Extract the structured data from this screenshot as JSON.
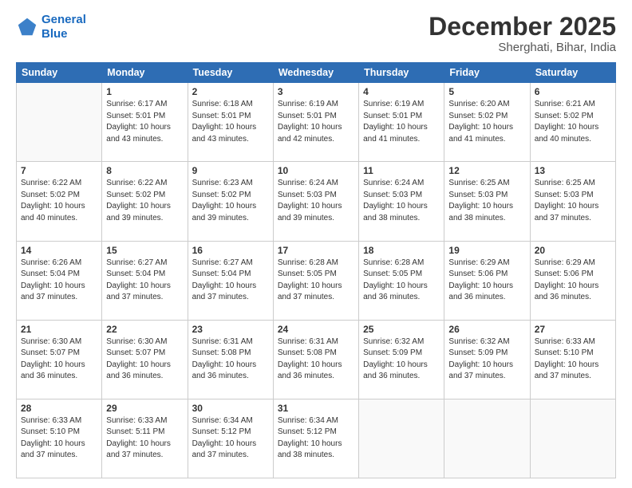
{
  "header": {
    "logo_line1": "General",
    "logo_line2": "Blue",
    "month": "December 2025",
    "location": "Sherghati, Bihar, India"
  },
  "weekdays": [
    "Sunday",
    "Monday",
    "Tuesday",
    "Wednesday",
    "Thursday",
    "Friday",
    "Saturday"
  ],
  "weeks": [
    [
      {
        "day": "",
        "info": ""
      },
      {
        "day": "1",
        "info": "Sunrise: 6:17 AM\nSunset: 5:01 PM\nDaylight: 10 hours\nand 43 minutes."
      },
      {
        "day": "2",
        "info": "Sunrise: 6:18 AM\nSunset: 5:01 PM\nDaylight: 10 hours\nand 43 minutes."
      },
      {
        "day": "3",
        "info": "Sunrise: 6:19 AM\nSunset: 5:01 PM\nDaylight: 10 hours\nand 42 minutes."
      },
      {
        "day": "4",
        "info": "Sunrise: 6:19 AM\nSunset: 5:01 PM\nDaylight: 10 hours\nand 41 minutes."
      },
      {
        "day": "5",
        "info": "Sunrise: 6:20 AM\nSunset: 5:02 PM\nDaylight: 10 hours\nand 41 minutes."
      },
      {
        "day": "6",
        "info": "Sunrise: 6:21 AM\nSunset: 5:02 PM\nDaylight: 10 hours\nand 40 minutes."
      }
    ],
    [
      {
        "day": "7",
        "info": "Sunrise: 6:22 AM\nSunset: 5:02 PM\nDaylight: 10 hours\nand 40 minutes."
      },
      {
        "day": "8",
        "info": "Sunrise: 6:22 AM\nSunset: 5:02 PM\nDaylight: 10 hours\nand 39 minutes."
      },
      {
        "day": "9",
        "info": "Sunrise: 6:23 AM\nSunset: 5:02 PM\nDaylight: 10 hours\nand 39 minutes."
      },
      {
        "day": "10",
        "info": "Sunrise: 6:24 AM\nSunset: 5:03 PM\nDaylight: 10 hours\nand 39 minutes."
      },
      {
        "day": "11",
        "info": "Sunrise: 6:24 AM\nSunset: 5:03 PM\nDaylight: 10 hours\nand 38 minutes."
      },
      {
        "day": "12",
        "info": "Sunrise: 6:25 AM\nSunset: 5:03 PM\nDaylight: 10 hours\nand 38 minutes."
      },
      {
        "day": "13",
        "info": "Sunrise: 6:25 AM\nSunset: 5:03 PM\nDaylight: 10 hours\nand 37 minutes."
      }
    ],
    [
      {
        "day": "14",
        "info": "Sunrise: 6:26 AM\nSunset: 5:04 PM\nDaylight: 10 hours\nand 37 minutes."
      },
      {
        "day": "15",
        "info": "Sunrise: 6:27 AM\nSunset: 5:04 PM\nDaylight: 10 hours\nand 37 minutes."
      },
      {
        "day": "16",
        "info": "Sunrise: 6:27 AM\nSunset: 5:04 PM\nDaylight: 10 hours\nand 37 minutes."
      },
      {
        "day": "17",
        "info": "Sunrise: 6:28 AM\nSunset: 5:05 PM\nDaylight: 10 hours\nand 37 minutes."
      },
      {
        "day": "18",
        "info": "Sunrise: 6:28 AM\nSunset: 5:05 PM\nDaylight: 10 hours\nand 36 minutes."
      },
      {
        "day": "19",
        "info": "Sunrise: 6:29 AM\nSunset: 5:06 PM\nDaylight: 10 hours\nand 36 minutes."
      },
      {
        "day": "20",
        "info": "Sunrise: 6:29 AM\nSunset: 5:06 PM\nDaylight: 10 hours\nand 36 minutes."
      }
    ],
    [
      {
        "day": "21",
        "info": "Sunrise: 6:30 AM\nSunset: 5:07 PM\nDaylight: 10 hours\nand 36 minutes."
      },
      {
        "day": "22",
        "info": "Sunrise: 6:30 AM\nSunset: 5:07 PM\nDaylight: 10 hours\nand 36 minutes."
      },
      {
        "day": "23",
        "info": "Sunrise: 6:31 AM\nSunset: 5:08 PM\nDaylight: 10 hours\nand 36 minutes."
      },
      {
        "day": "24",
        "info": "Sunrise: 6:31 AM\nSunset: 5:08 PM\nDaylight: 10 hours\nand 36 minutes."
      },
      {
        "day": "25",
        "info": "Sunrise: 6:32 AM\nSunset: 5:09 PM\nDaylight: 10 hours\nand 36 minutes."
      },
      {
        "day": "26",
        "info": "Sunrise: 6:32 AM\nSunset: 5:09 PM\nDaylight: 10 hours\nand 37 minutes."
      },
      {
        "day": "27",
        "info": "Sunrise: 6:33 AM\nSunset: 5:10 PM\nDaylight: 10 hours\nand 37 minutes."
      }
    ],
    [
      {
        "day": "28",
        "info": "Sunrise: 6:33 AM\nSunset: 5:10 PM\nDaylight: 10 hours\nand 37 minutes."
      },
      {
        "day": "29",
        "info": "Sunrise: 6:33 AM\nSunset: 5:11 PM\nDaylight: 10 hours\nand 37 minutes."
      },
      {
        "day": "30",
        "info": "Sunrise: 6:34 AM\nSunset: 5:12 PM\nDaylight: 10 hours\nand 37 minutes."
      },
      {
        "day": "31",
        "info": "Sunrise: 6:34 AM\nSunset: 5:12 PM\nDaylight: 10 hours\nand 38 minutes."
      },
      {
        "day": "",
        "info": ""
      },
      {
        "day": "",
        "info": ""
      },
      {
        "day": "",
        "info": ""
      }
    ]
  ]
}
